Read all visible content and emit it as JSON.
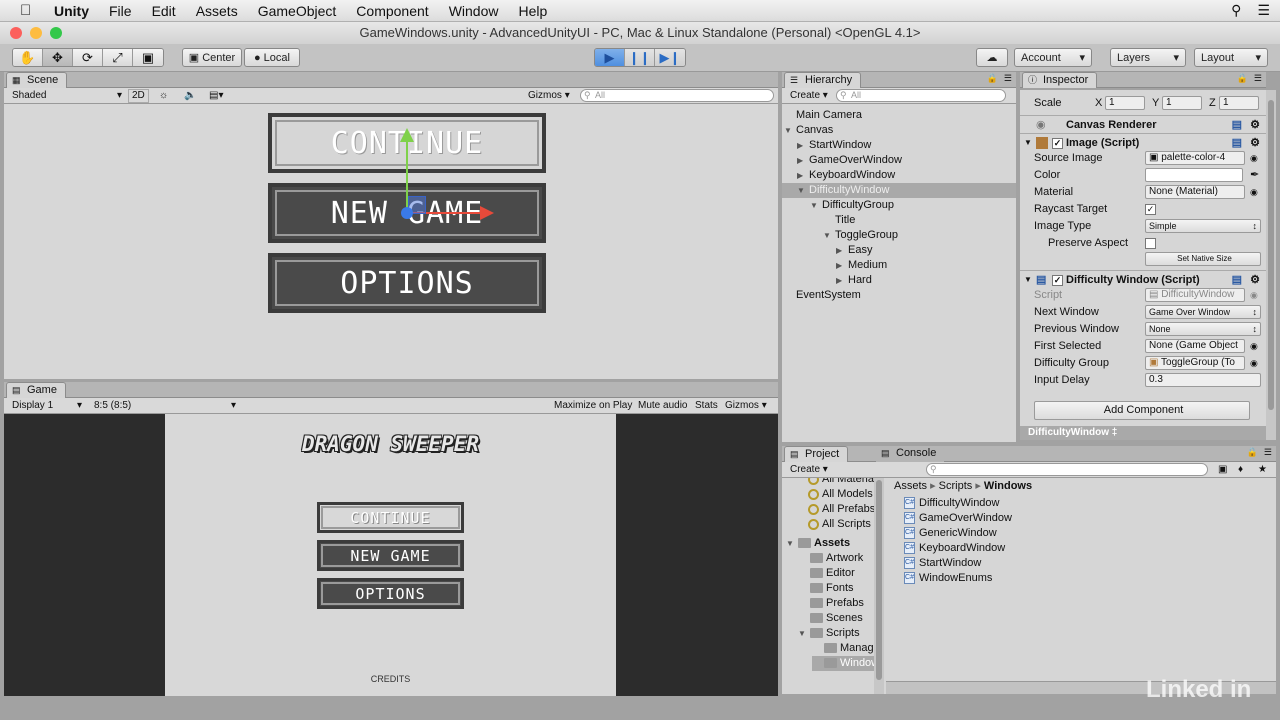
{
  "menubar": {
    "apple_icon": "apple-logo",
    "items": [
      "Unity",
      "File",
      "Edit",
      "Assets",
      "GameObject",
      "Component",
      "Window",
      "Help"
    ]
  },
  "window_title": "GameWindows.unity - AdvancedUnityUI - PC, Mac & Linux Standalone (Personal) <OpenGL 4.1>",
  "toolbar": {
    "pivot": "Center",
    "space": "Local",
    "account": "Account",
    "layers": "Layers",
    "layout": "Layout"
  },
  "scene": {
    "tab": "Scene",
    "shading": "Shaded",
    "mode_2d": "2D",
    "gizmos": "Gizmos",
    "search_placeholder": "All",
    "buttons": [
      "CONTINUE",
      "NEW GAME",
      "OPTIONS"
    ]
  },
  "game": {
    "tab": "Game",
    "display": "Display 1",
    "aspect": "8:5 (8:5)",
    "maximize": "Maximize on Play",
    "mute": "Mute audio",
    "stats": "Stats",
    "gizmos": "Gizmos",
    "title": "DRAGON SWEEPER",
    "buttons": [
      "CONTINUE",
      "NEW GAME",
      "OPTIONS"
    ],
    "credits": "CREDITS"
  },
  "hierarchy": {
    "tab": "Hierarchy",
    "create": "Create",
    "search_placeholder": "All",
    "rows": [
      {
        "label": "Main Camera",
        "indent": 0,
        "arrow": ""
      },
      {
        "label": "Canvas",
        "indent": 0,
        "arrow": "▼"
      },
      {
        "label": "StartWindow",
        "indent": 1,
        "arrow": "▶"
      },
      {
        "label": "GameOverWindow",
        "indent": 1,
        "arrow": "▶"
      },
      {
        "label": "KeyboardWindow",
        "indent": 1,
        "arrow": "▶"
      },
      {
        "label": "DifficultyWindow",
        "indent": 1,
        "arrow": "▼",
        "selected": true
      },
      {
        "label": "DifficultyGroup",
        "indent": 2,
        "arrow": "▼"
      },
      {
        "label": "Title",
        "indent": 3,
        "arrow": ""
      },
      {
        "label": "ToggleGroup",
        "indent": 3,
        "arrow": "▼"
      },
      {
        "label": "Easy",
        "indent": 4,
        "arrow": "▶"
      },
      {
        "label": "Medium",
        "indent": 4,
        "arrow": "▶"
      },
      {
        "label": "Hard",
        "indent": 4,
        "arrow": "▶"
      },
      {
        "label": "EventSystem",
        "indent": 0,
        "arrow": ""
      }
    ]
  },
  "inspector": {
    "tab": "Inspector",
    "scale": {
      "label": "Scale",
      "x": "1",
      "y": "1",
      "z": "1"
    },
    "canvas_renderer": "Canvas Renderer",
    "image_script": "Image (Script)",
    "source_image_label": "Source Image",
    "source_image": "palette-color-4",
    "color_label": "Color",
    "material_label": "Material",
    "material": "None (Material)",
    "raycast_label": "Raycast Target",
    "image_type_label": "Image Type",
    "image_type": "Simple",
    "preserve_label": "Preserve Aspect",
    "set_native": "Set Native Size",
    "difficulty_script": "Difficulty Window (Script)",
    "script_label": "Script",
    "script_value": "DifficultyWindow",
    "next_label": "Next Window",
    "next_value": "Game Over Window",
    "prev_label": "Previous Window",
    "prev_value": "None",
    "first_label": "First Selected",
    "first_value": "None (Game Object",
    "group_label": "Difficulty Group",
    "group_value": "ToggleGroup (To",
    "delay_label": "Input Delay",
    "delay_value": "0.3",
    "add_component": "Add Component",
    "footer": "DifficultyWindow ‡"
  },
  "project": {
    "tab": "Project",
    "console_tab": "Console",
    "create": "Create",
    "favorites": [
      "All Materia",
      "All Models",
      "All Prefabs",
      "All Scripts"
    ],
    "assets_label": "Assets",
    "folders": [
      "Artwork",
      "Editor",
      "Fonts",
      "Prefabs",
      "Scenes",
      "Scripts",
      "Manage",
      "Window"
    ],
    "breadcrumb": [
      "Assets",
      "Scripts",
      "Windows"
    ],
    "files": [
      "DifficultyWindow",
      "GameOverWindow",
      "GenericWindow",
      "KeyboardWindow",
      "StartWindow",
      "WindowEnums"
    ]
  },
  "watermark": "Linked in"
}
